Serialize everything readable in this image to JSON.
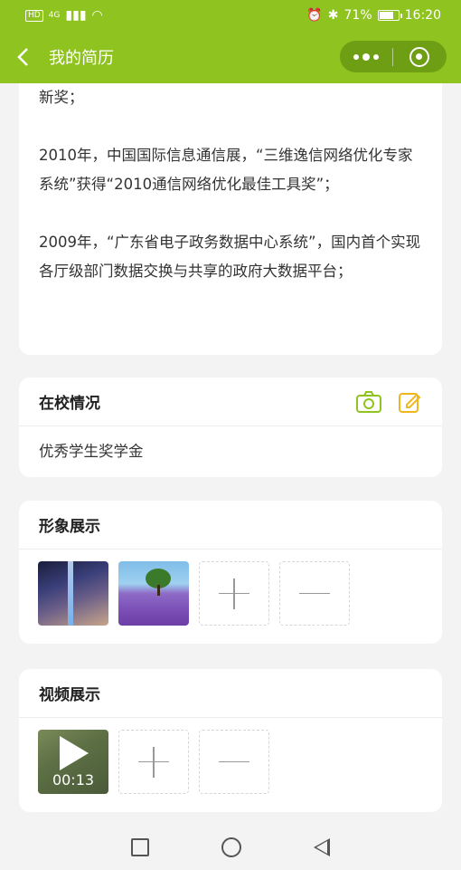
{
  "status_bar": {
    "left_badges": [
      "HD",
      "4G"
    ],
    "battery": "71%",
    "time": "16:20",
    "battery_level": 0.71
  },
  "header": {
    "back_icon": "chevron-left-icon",
    "title": "我的简历",
    "capsule": {
      "more_icon": "more-dots-icon",
      "target_icon": "target-icon"
    }
  },
  "awards_card": {
    "paragraphs": [
      "新奖；",
      "2010年，中国国际信息通信展，“三维逸信网络优化专家系统”获得“2010通信网络优化最佳工具奖”；",
      "2009年，“广东省电子政务数据中心系统”，国内首个实现各厅级部门数据交换与共享的政府大数据平台；"
    ]
  },
  "school_card": {
    "title": "在校情况",
    "body": "优秀学生奖学金",
    "icons": [
      "camera-icon",
      "edit-icon"
    ],
    "accent": "#8fc31f"
  },
  "image_card": {
    "title": "形象展示",
    "images": [
      "night-sky-photo",
      "lavender-field-photo"
    ]
  },
  "video_card": {
    "title": "视频展示",
    "video_duration": "00:13"
  },
  "colors": {
    "brand": "#8fc31f",
    "brand_dark": "#6e9e14",
    "icon_yellow": "#f0b61e",
    "background": "#f3f3f3"
  }
}
